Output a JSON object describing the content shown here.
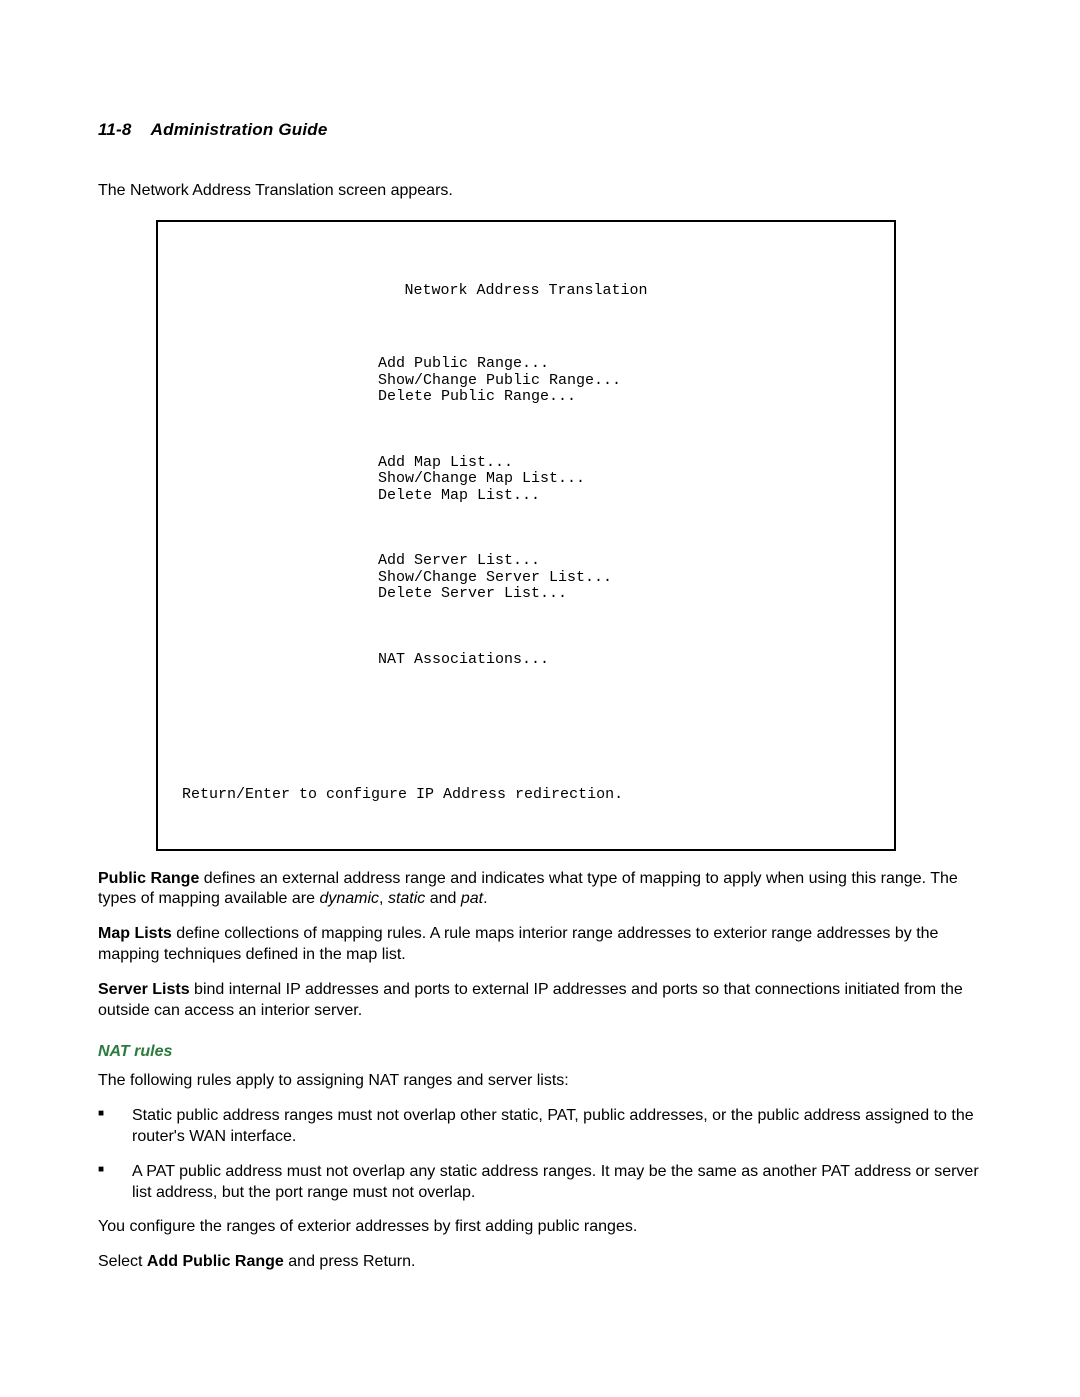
{
  "header": {
    "pagenum": "11-8",
    "title": "Administration Guide"
  },
  "intro": "The Network Address Translation screen appears.",
  "screen": {
    "title": "Network Address Translation",
    "group1": "Add Public Range...\nShow/Change Public Range...\nDelete Public Range...",
    "group2": "Add Map List...\nShow/Change Map List...\nDelete Map List...",
    "group3": "Add Server List...\nShow/Change Server List...\nDelete Server List...",
    "group4": "NAT Associations...",
    "footer": "Return/Enter to configure IP Address redirection."
  },
  "para_public_range": {
    "lead": "Public Range",
    "text1": " defines an external address range and indicates what type of mapping to apply when using this range. The types of mapping available are ",
    "i1": "dynamic",
    "sep1": ", ",
    "i2": "static",
    "sep2": " and ",
    "i3": "pat",
    "end": "."
  },
  "para_map_lists": {
    "lead": "Map Lists",
    "text": " define collections of mapping rules. A rule maps interior range addresses to exterior range addresses by the mapping techniques defined in the map list."
  },
  "para_server_lists": {
    "lead": "Server Lists",
    "text": " bind internal IP addresses and ports to external IP addresses and ports so that connections initiated from the outside can access an interior server."
  },
  "nat_rules_heading": "NAT rules",
  "nat_rules_intro": "The following rules apply to assigning NAT ranges and server lists:",
  "bullets": [
    "Static public address ranges must not overlap other static, PAT, public addresses, or the public address assigned to the router's WAN interface.",
    "A PAT public address must not overlap any static address ranges. It may be the same as another PAT address or server list address, but the port range must not overlap."
  ],
  "config_line": "You configure the ranges of exterior addresses by first adding public ranges.",
  "select_line": {
    "pre": "Select ",
    "bold": "Add Public Range",
    "post": " and press Return."
  }
}
